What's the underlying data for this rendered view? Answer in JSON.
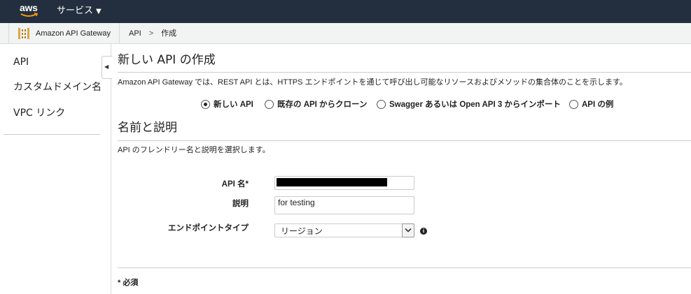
{
  "topbar": {
    "logo_text": "aws",
    "services_label": "サービス",
    "services_caret": "▼"
  },
  "breadcrumb": {
    "service_name": "Amazon API Gateway",
    "items": [
      "API",
      "作成"
    ],
    "separator": ">"
  },
  "sidebar": {
    "items": [
      {
        "label": "API"
      },
      {
        "label": "カスタムドメイン名"
      },
      {
        "label": "VPC リンク"
      }
    ],
    "collapse_glyph": "◀"
  },
  "main": {
    "title": "新しい API の作成",
    "description": "Amazon API Gateway では、REST API とは、HTTPS エンドポイントを通じて呼び出し可能なリソースおよびメソッドの集合体のことを示します。",
    "create_options": [
      {
        "label": "新しい API",
        "selected": true
      },
      {
        "label": "既存の API からクローン",
        "selected": false
      },
      {
        "label": "Swagger あるいは Open API 3 からインポート",
        "selected": false
      },
      {
        "label": "API の例",
        "selected": false
      }
    ],
    "section_title": "名前と説明",
    "section_description": "API のフレンドリー名と説明を選択します。",
    "form": {
      "api_name_label": "API 名*",
      "api_name_value": "",
      "description_label": "説明",
      "description_value": "for testing",
      "endpoint_type_label": "エンドポイントタイプ",
      "endpoint_type_value": "リージョン"
    },
    "required_note": "* 必須"
  },
  "colors": {
    "topbar_bg": "#232f3e",
    "crumbbar_bg": "#f2f3f3",
    "gateway_icon": "#d9a741"
  }
}
